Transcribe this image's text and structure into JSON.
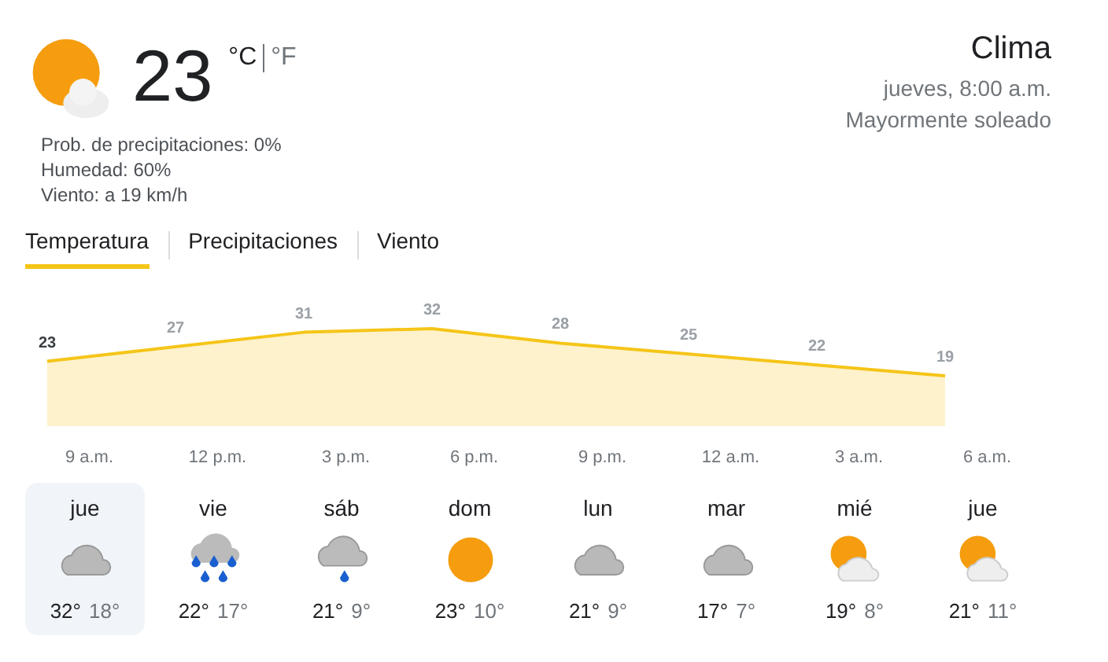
{
  "current": {
    "temperature": "23",
    "units": [
      {
        "label": "°C",
        "selected": true
      },
      {
        "label": "°F",
        "selected": false
      }
    ],
    "kind": "partly-cloudy",
    "details": [
      "Prob. de precipitaciones: 0%",
      "Humedad: 60%",
      "Viento: a 19 km/h"
    ]
  },
  "location": {
    "title": "Clima",
    "time": "jueves, 8:00 a.m.",
    "condition": "Mayormente soleado"
  },
  "tabs": [
    {
      "label": "Temperatura",
      "selected": true
    },
    {
      "label": "Precipitaciones",
      "selected": false
    },
    {
      "label": "Viento",
      "selected": false
    }
  ],
  "chart": {
    "time_labels": [
      "9 a.m.",
      "12 p.m.",
      "3 p.m.",
      "6 p.m.",
      "9 p.m.",
      "12 a.m.",
      "3 a.m.",
      "6 a.m."
    ],
    "chart_data": {
      "type": "area",
      "categories": [
        null,
        null,
        null,
        null,
        null,
        null,
        null,
        null
      ],
      "series": [
        {
          "color": "#f5c518",
          "values": [
            23,
            27,
            31,
            32,
            28,
            25,
            22,
            19
          ]
        }
      ],
      "data_labels": true
    }
  },
  "forecast": [
    {
      "day": "jue",
      "kind": "cloudy",
      "high": "32°",
      "low": "18°",
      "selected": true
    },
    {
      "day": "vie",
      "kind": "heavy-rain",
      "high": "22°",
      "low": "17°",
      "selected": false
    },
    {
      "day": "sáb",
      "kind": "rain",
      "high": "21°",
      "low": "9°",
      "selected": false
    },
    {
      "day": "dom",
      "kind": "sunny",
      "high": "23°",
      "low": "10°",
      "selected": false
    },
    {
      "day": "lun",
      "kind": "cloudy",
      "high": "21°",
      "low": "9°",
      "selected": false
    },
    {
      "day": "mar",
      "kind": "cloudy",
      "high": "17°",
      "low": "7°",
      "selected": false
    },
    {
      "day": "mié",
      "kind": "partly-cloudy",
      "high": "19°",
      "low": "8°",
      "selected": false
    },
    {
      "day": "jue",
      "kind": "partly-cloudy",
      "high": "21°",
      "low": "11°",
      "selected": false
    }
  ]
}
